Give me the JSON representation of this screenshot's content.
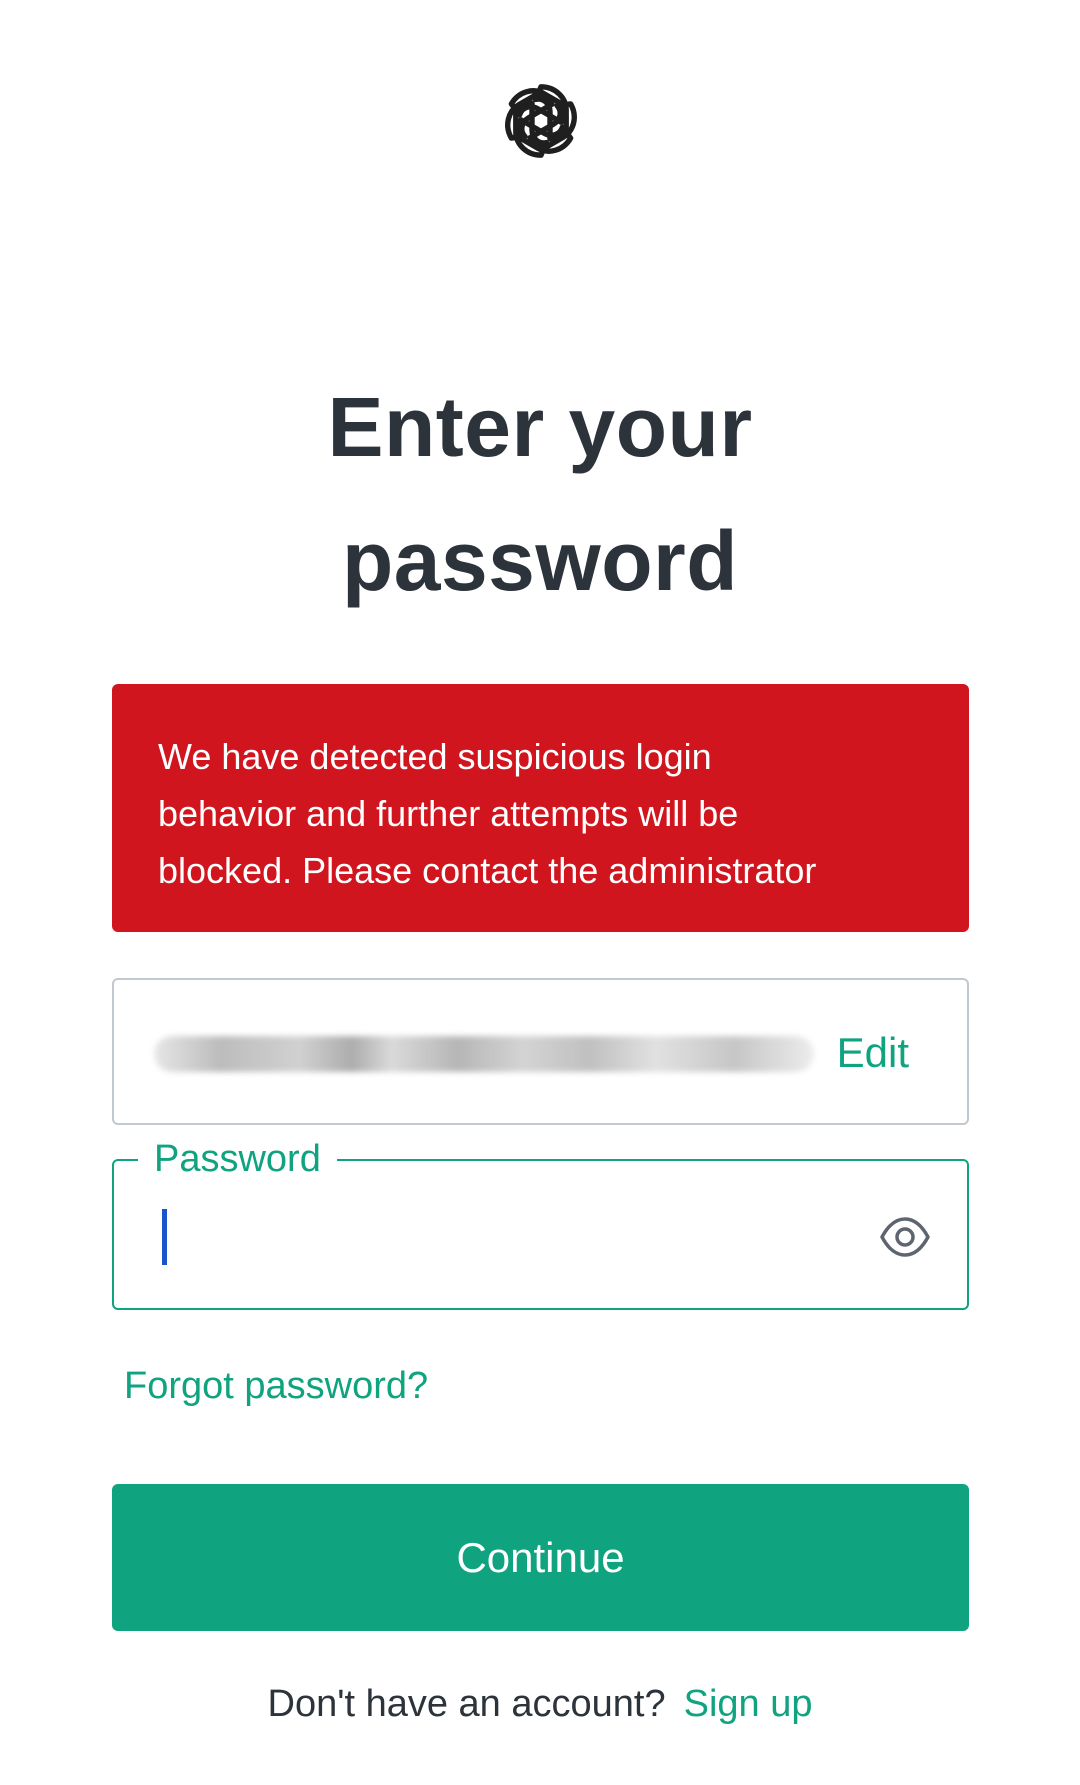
{
  "logo": {
    "icon": "openai-logo-icon"
  },
  "heading": {
    "line1": "Enter your",
    "line2": "password"
  },
  "alert": {
    "line1": "We have detected suspicious login",
    "line2": "behavior and further attempts will be",
    "line3": "blocked. Please contact the administrator",
    "color": "#d1151e"
  },
  "email": {
    "edit_label": "Edit"
  },
  "password": {
    "label": "Password",
    "value": "",
    "toggle_icon": "eye-icon"
  },
  "links": {
    "forgot": "Forgot password?"
  },
  "actions": {
    "continue_label": "Continue"
  },
  "footer": {
    "prompt": "Don't have an account?",
    "signup_label": "Sign up"
  },
  "colors": {
    "accent": "#10a37f",
    "text": "#2d333a",
    "error": "#d1151e"
  }
}
